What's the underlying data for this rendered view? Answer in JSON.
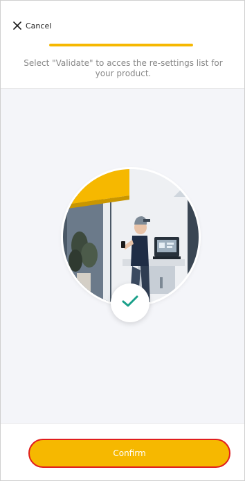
{
  "header": {
    "cancel_label": "Cancel",
    "cancel_icon": "close-icon",
    "progress": 1.0,
    "instruction": "Select \"Validate\" to acces the re-settings list for your product."
  },
  "illustration": {
    "icon": "person-with-phone-illustration",
    "badge_icon": "checkmark-icon"
  },
  "footer": {
    "confirm_label": "Confirm"
  },
  "colors": {
    "accent": "#f6b800",
    "check": "#1aa08a",
    "button_outline": "#e01e1e",
    "background": "#f4f5f9"
  }
}
